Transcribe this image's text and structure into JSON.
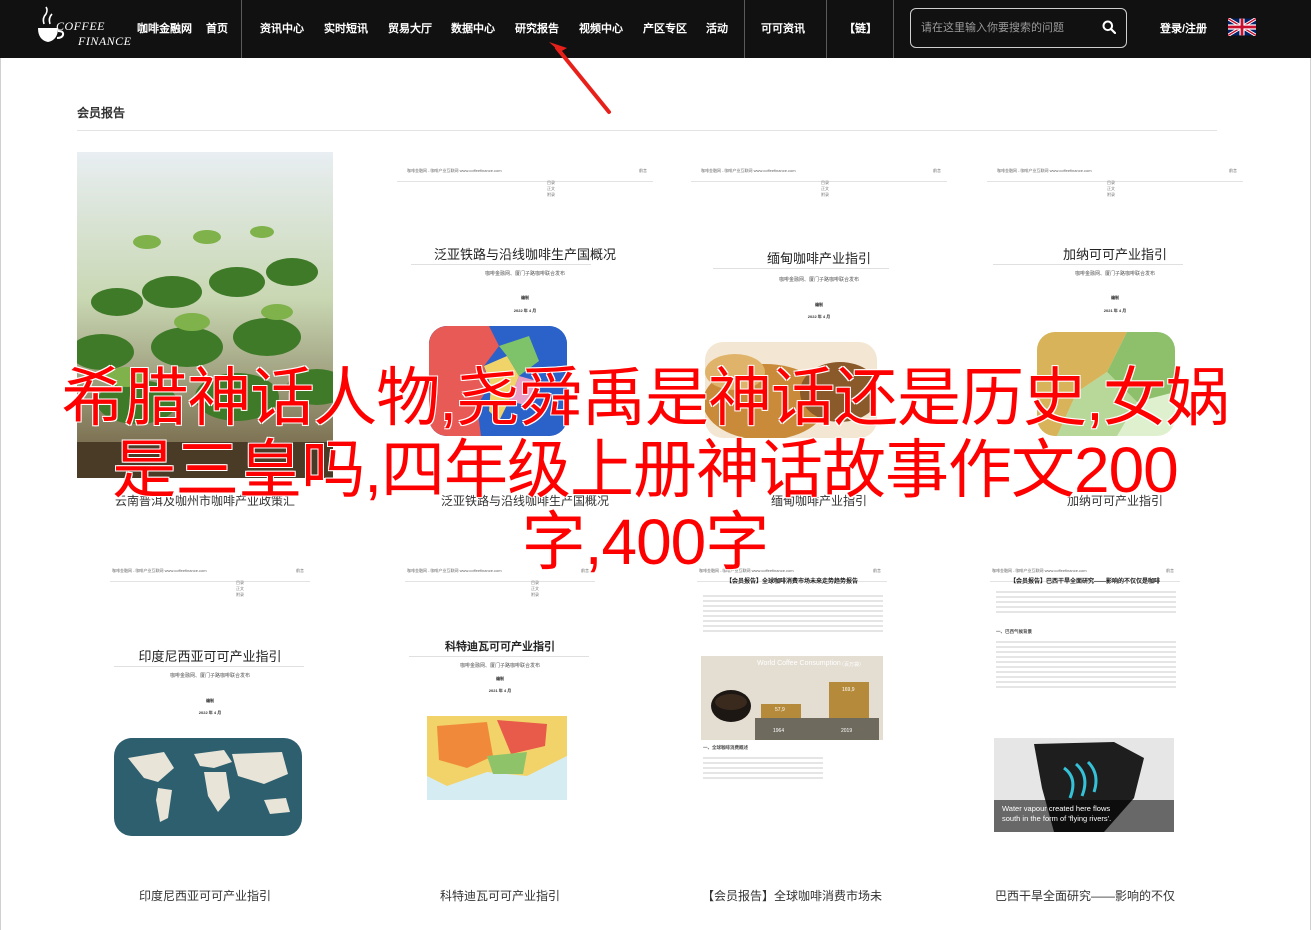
{
  "header": {
    "logo_line1": "COFFEE",
    "logo_line2": "FINANCE",
    "brand_link": "咖啡金融网",
    "home": "首页",
    "nav": [
      "资讯中心",
      "实时短讯",
      "贸易大厅",
      "数据中心",
      "研究报告",
      "视频中心",
      "产区专区",
      "活动"
    ],
    "extra_nav": "可可资讯",
    "chain": "【链】",
    "search_placeholder": "请在这里输入你要搜索的问题",
    "login": "登录/注册"
  },
  "section": {
    "title": "会员报告"
  },
  "overlay_title": "希腊神话人物,尧舜禹是神话还是历史,女娲是三皇吗,四年级上册神话故事作文200字,400字",
  "doc_common": {
    "header_left": "咖啡金融网 - 咖啡产业互联网 www.coffeefinance.com",
    "toc": [
      "前言",
      "目录",
      "正文",
      "附录"
    ],
    "publisher": "咖啡金融网、厦门子路咖啡联合发布",
    "org": "编制",
    "date": "2022 年 4 月",
    "date2": "2021 年 4 月"
  },
  "cards_row1": [
    {
      "caption": "云南普洱及咖州市咖啡产业政策汇"
    },
    {
      "title": "泛亚铁路与沿线咖啡生产国概况",
      "caption": "泛亚铁路与沿线咖啡生产国概况"
    },
    {
      "title": "缅甸咖啡产业指引",
      "caption": "缅甸咖啡产业指引"
    },
    {
      "title": "加纳可可产业指引",
      "caption": "加纳可可产业指引"
    }
  ],
  "cards_row2": [
    {
      "title": "印度尼西亚可可产业指引",
      "caption": "印度尼西亚可可产业指引"
    },
    {
      "title": "科特迪瓦可可产业指引",
      "caption": "科特迪瓦可可产业指引"
    },
    {
      "title": "【会员报告】全球咖啡消费市场未来走势趋势报告",
      "caption": "【会员报告】全球咖啡消费市场未",
      "chart_title": "World Coffee Consumption",
      "chart_unit": "（百万袋）",
      "bar1_label": "1964",
      "bar1_value": "57,9",
      "bar2_label": "2019",
      "bar2_value": "169,9",
      "section_heading": "一、全球咖啡消费概述"
    },
    {
      "title": "【会员报告】巴西干旱全面研究——影响的不仅仅是咖啡",
      "caption": "巴西干旱全面研究——影响的不仅",
      "section_heading": "一、巴西气候背景",
      "map_caption_1": "Water vapour created here flows",
      "map_caption_2": "south in the form of 'flying rivers'."
    }
  ]
}
